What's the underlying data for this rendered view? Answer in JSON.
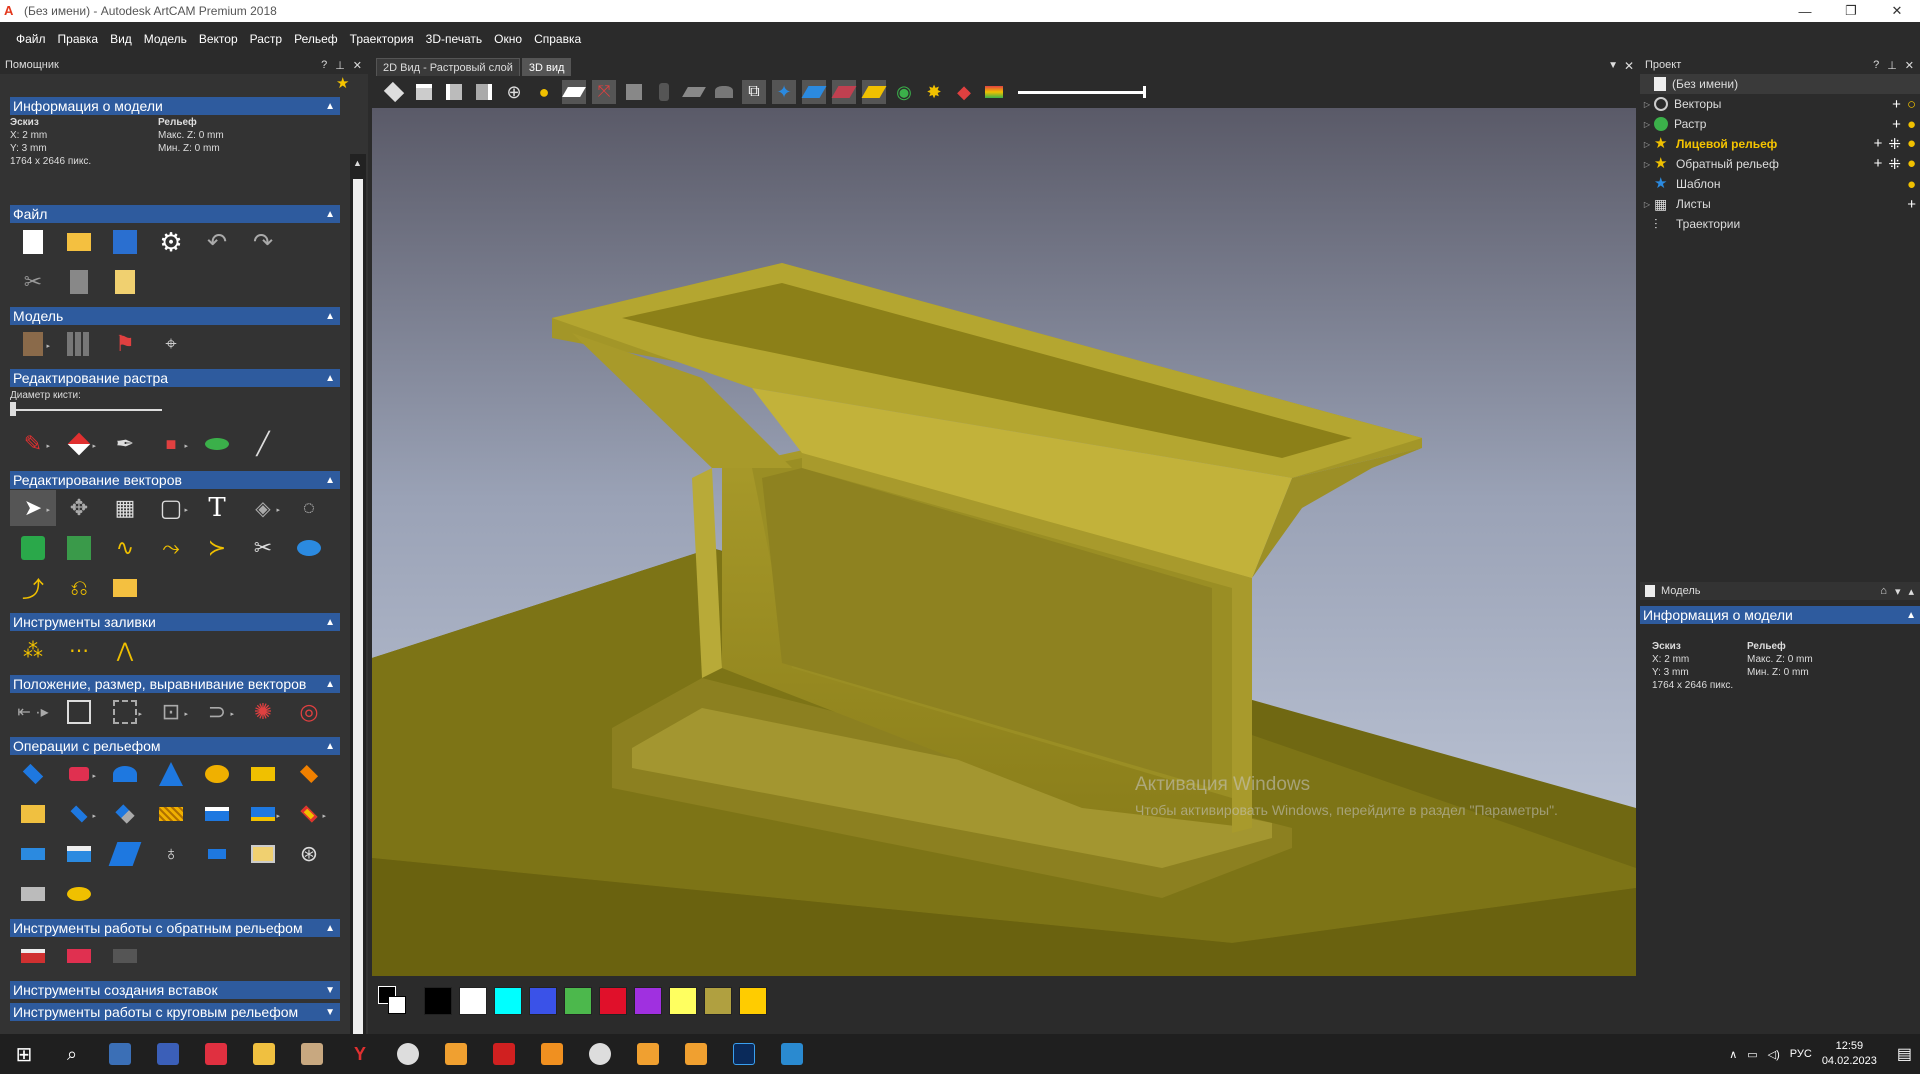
{
  "window": {
    "title": "(Без имени) - Autodesk ArtCAM Premium 2018"
  },
  "menu": [
    "Файл",
    "Правка",
    "Вид",
    "Модель",
    "Вектор",
    "Растр",
    "Рельеф",
    "Траектория",
    "3D-печать",
    "Окно",
    "Справка"
  ],
  "left_panel": {
    "title": "Помощник",
    "model_info": {
      "header": "Информация о модели",
      "sketch_label": "Эскиз",
      "relief_label": "Рельеф",
      "x": "X: 2 mm",
      "y": "Y: 3 mm",
      "size": "1764 x 2646 пикс.",
      "max_z": "Макс. Z: 0 mm",
      "min_z": "Мин. Z: 0 mm"
    },
    "sections": {
      "file": "Файл",
      "model": "Модель",
      "raster_edit": "Редактирование растра",
      "vector_edit": "Редактирование векторов",
      "fill_tools": "Инструменты заливки",
      "position": "Положение, размер, выравнивание векторов",
      "relief_ops": "Операции с рельефом",
      "back_relief": "Инструменты работы с обратным рельефом",
      "inserts": "Инструменты создания вставок",
      "rotary": "Инструменты работы с круговым рельефом"
    },
    "brush_label": "Диаметр кисти:"
  },
  "tabs": [
    {
      "label": "2D Вид - Растровый слой"
    },
    {
      "label": "3D вид"
    }
  ],
  "palette": {
    "colors": [
      "#000000",
      "#ffffff",
      "#00ffff",
      "#3a52e8",
      "#4cb84c",
      "#e0102a",
      "#a030e0",
      "#ffff60",
      "#b0a040",
      "#ffcc00"
    ]
  },
  "right_panel": {
    "title": "Проект",
    "tree": [
      {
        "label": "(Без имени)"
      },
      {
        "label": "Векторы"
      },
      {
        "label": "Растр"
      },
      {
        "label": "Лицевой рельеф"
      },
      {
        "label": "Обратный рельеф"
      },
      {
        "label": "Шаблон"
      },
      {
        "label": "Листы"
      },
      {
        "label": "Траектории"
      }
    ],
    "model_panel": {
      "title": "Модель",
      "info_header": "Информация о модели",
      "sketch_label": "Эскиз",
      "relief_label": "Рельеф",
      "x": "X: 2 mm",
      "y": "Y: 3 mm",
      "size": "1764 x 2646 пикс.",
      "max_z": "Макс. Z: 0 mm",
      "min_z": "Мин. Z: 0 mm"
    }
  },
  "watermark": {
    "title": "Активация Windows",
    "subtitle": "Чтобы активировать Windows, перейдите в раздел \"Параметры\"."
  },
  "tray": {
    "lang": "РУС",
    "time": "12:59",
    "date": "04.02.2023"
  }
}
